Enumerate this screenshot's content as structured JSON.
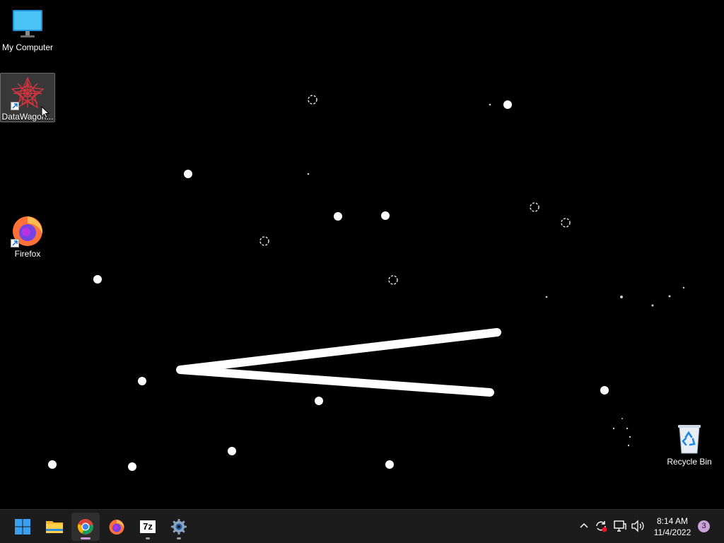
{
  "desktop": {
    "icons": [
      {
        "label": "My Computer",
        "icon": "monitor-icon"
      },
      {
        "label": "DataWagon...",
        "icon": "datawagon-icon"
      },
      {
        "label": "Firefox",
        "icon": "firefox-icon"
      },
      {
        "label": "Recycle Bin",
        "icon": "recycle-bin-icon"
      }
    ]
  },
  "taskbar": {
    "pinned": [
      {
        "name": "start-button",
        "icon": "windows-logo-icon"
      },
      {
        "name": "file-explorer",
        "icon": "folder-icon"
      },
      {
        "name": "chrome",
        "icon": "chrome-icon"
      },
      {
        "name": "firefox",
        "icon": "firefox-icon"
      },
      {
        "name": "7zip",
        "icon": "7zip-icon",
        "label": "7z"
      },
      {
        "name": "settings",
        "icon": "gear-icon"
      }
    ],
    "tray": {
      "icons": [
        "chevron-up-icon",
        "sync-icon",
        "network-icon",
        "volume-icon"
      ],
      "time": "8:14 AM",
      "date": "11/4/2022",
      "notifications": "3"
    }
  },
  "colors": {
    "desktop_bg": "#000000",
    "taskbar_bg": "#1c1c1c",
    "accent": "#c99ad6"
  }
}
